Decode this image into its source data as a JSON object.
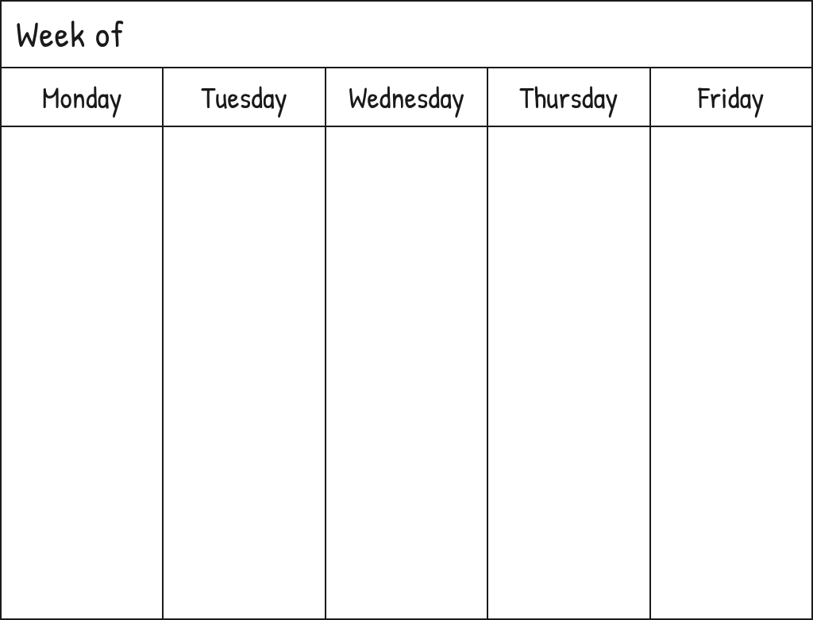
{
  "header": {
    "title": "Week of"
  },
  "calendar": {
    "days": [
      {
        "label": "Monday"
      },
      {
        "label": "Tuesday"
      },
      {
        "label": "Wednesday"
      },
      {
        "label": "Thursday"
      },
      {
        "label": "Friday"
      }
    ]
  }
}
